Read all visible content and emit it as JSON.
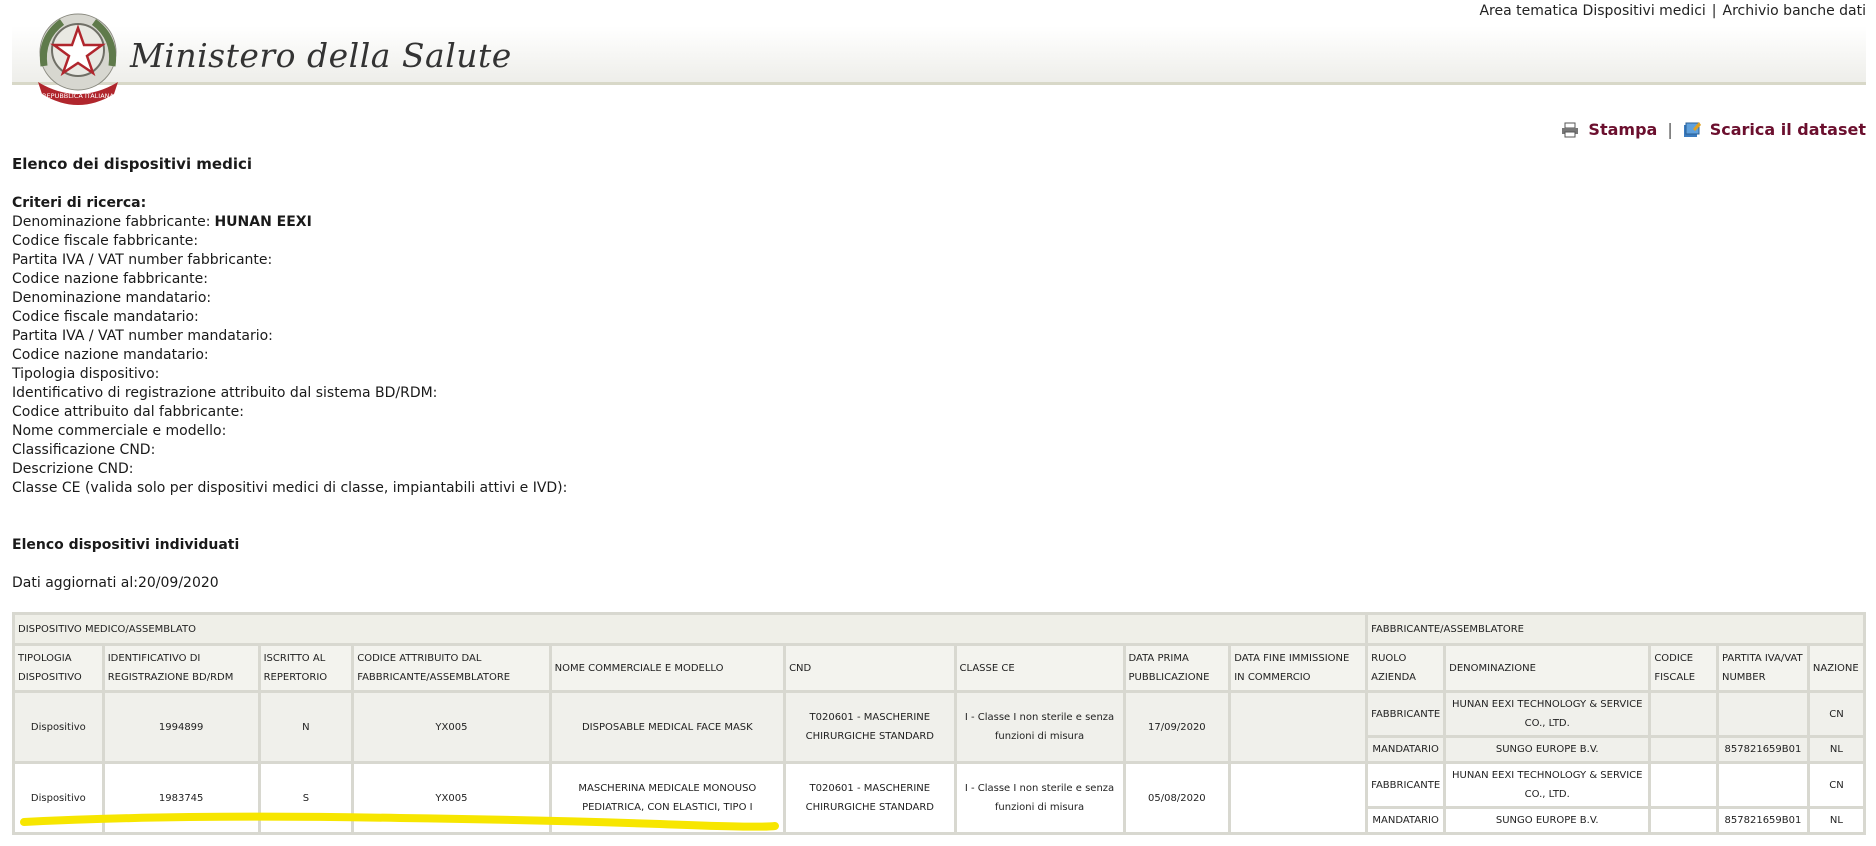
{
  "topnav": {
    "link1": "Area tematica Dispositivi medici",
    "sep": "|",
    "link2": "Archivio banche dati"
  },
  "header": {
    "ministry_name": "Ministero della Salute",
    "emblem_text": "REPUBBLICA ITALIANA"
  },
  "actions": {
    "print_label": "Stampa",
    "sep": "|",
    "download_label": "Scarica il dataset"
  },
  "page": {
    "title": "Elenco dei dispositivi medici",
    "criteria_label": "Criteri di ricerca:",
    "criteria": [
      {
        "label": "Denominazione fabbricante:",
        "value": "HUNAN EEXI"
      },
      {
        "label": "Codice fiscale fabbricante:",
        "value": ""
      },
      {
        "label": "Partita IVA / VAT number fabbricante:",
        "value": ""
      },
      {
        "label": "Codice nazione fabbricante:",
        "value": ""
      },
      {
        "label": "Denominazione mandatario:",
        "value": ""
      },
      {
        "label": "Codice fiscale mandatario:",
        "value": ""
      },
      {
        "label": "Partita IVA / VAT number mandatario:",
        "value": ""
      },
      {
        "label": "Codice nazione mandatario:",
        "value": ""
      },
      {
        "label": "Tipologia dispositivo:",
        "value": ""
      },
      {
        "label": "Identificativo di registrazione attribuito dal sistema BD/RDM:",
        "value": ""
      },
      {
        "label": "Codice attribuito dal fabbricante:",
        "value": ""
      },
      {
        "label": "Nome commerciale e modello:",
        "value": ""
      },
      {
        "label": "Classificazione CND:",
        "value": ""
      },
      {
        "label": "Descrizione CND:",
        "value": ""
      },
      {
        "label": "Classe CE (valida solo per dispositivi medici di classe, impiantabili attivi e IVD):",
        "value": ""
      }
    ],
    "found_label": "Elenco dispositivi individuati",
    "updated_label": "Dati aggiornati al:",
    "updated_value": "20/09/2020"
  },
  "table": {
    "group_device": "DISPOSITIVO MEDICO/ASSEMBLATO",
    "group_manufacturer": "FABBRICANTE/ASSEMBLATORE",
    "headers": [
      "TIPOLOGIA DISPOSITIVO",
      "IDENTIFICATIVO DI REGISTRAZIONE BD/RDM",
      "ISCRITTO AL REPERTORIO",
      "CODICE ATTRIBUITO DAL FABBRICANTE/ASSEMBLATORE",
      "NOME COMMERCIALE E MODELLO",
      "CND",
      "CLASSE CE",
      "DATA PRIMA PUBBLICAZIONE",
      "DATA FINE IMMISSIONE IN COMMERCIO",
      "RUOLO AZIENDA",
      "DENOMINAZIONE",
      "CODICE FISCALE",
      "PARTITA IVA/VAT NUMBER",
      "NAZIONE"
    ],
    "rows": [
      {
        "tipologia": "Dispositivo",
        "identificativo": "1994899",
        "iscritto": "N",
        "codice": "YX005",
        "nome": "DISPOSABLE MEDICAL FACE MASK",
        "cnd": "T020601 - MASCHERINE CHIRURGICHE STANDARD",
        "classe": "I - Classe I non sterile e senza funzioni di misura",
        "data_prima": "17/09/2020",
        "data_fine": "",
        "fab": {
          "ruolo": "FABBRICANTE",
          "denominazione": "HUNAN EEXI TECHNOLOGY & SERVICE CO., LTD.",
          "cf": "",
          "piva": "",
          "nazione": "CN"
        },
        "mand": {
          "ruolo": "MANDATARIO",
          "denominazione": "SUNGO EUROPE B.V.",
          "cf": "",
          "piva": "857821659B01",
          "nazione": "NL"
        }
      },
      {
        "tipologia": "Dispositivo",
        "identificativo": "1983745",
        "iscritto": "S",
        "codice": "YX005",
        "nome": "MASCHERINA MEDICALE MONOUSO PEDIATRICA, CON ELASTICI, TIPO I",
        "cnd": "T020601 - MASCHERINE CHIRURGICHE STANDARD",
        "classe": "I - Classe I non sterile e senza funzioni di misura",
        "data_prima": "05/08/2020",
        "data_fine": "",
        "fab": {
          "ruolo": "FABBRICANTE",
          "denominazione": "HUNAN EEXI TECHNOLOGY & SERVICE CO., LTD.",
          "cf": "",
          "piva": "",
          "nazione": "CN"
        },
        "mand": {
          "ruolo": "MANDATARIO",
          "denominazione": "SUNGO EUROPE B.V.",
          "cf": "",
          "piva": "857821659B01",
          "nazione": "NL"
        }
      }
    ]
  },
  "colors": {
    "accent": "#6b0f2e",
    "table_border": "#d8d8d0",
    "highlight": "#f7e600"
  },
  "icons": [
    "emblem-icon",
    "printer-icon",
    "dataset-download-icon"
  ]
}
